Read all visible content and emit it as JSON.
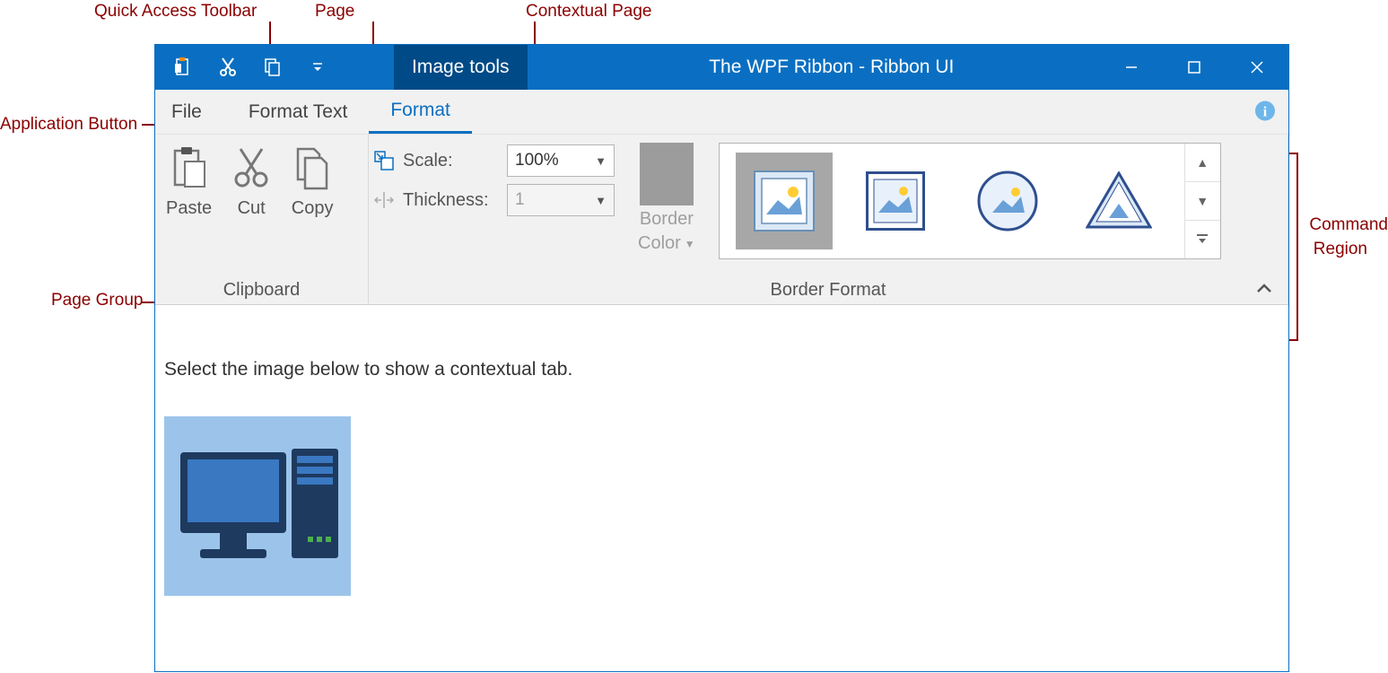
{
  "annotations": {
    "quick_access": "Quick Access Toolbar",
    "page": "Page",
    "contextual_page": "Contextual Page",
    "app_button": "Application Button",
    "page_group": "Page Group",
    "command_region_line1": "Command",
    "command_region_line2": "Region"
  },
  "titlebar": {
    "qat_icons": [
      "clipboard",
      "cut",
      "copy",
      "dropdown"
    ],
    "contextual_title": "Image tools",
    "window_title": "The WPF Ribbon - Ribbon UI"
  },
  "tabs": {
    "file": "File",
    "format_text": "Format Text",
    "format": "Format"
  },
  "ribbon": {
    "clipboard": {
      "label": "Clipboard",
      "paste": "Paste",
      "cut": "Cut",
      "copy": "Copy"
    },
    "scale_label": "Scale:",
    "scale_value": "100%",
    "thickness_label": "Thickness:",
    "thickness_value": "1",
    "border_color_label_line1": "Border",
    "border_color_label_line2": "Color",
    "border_format_label": "Border Format"
  },
  "content": {
    "instruction": "Select the image below to show a contextual tab."
  }
}
